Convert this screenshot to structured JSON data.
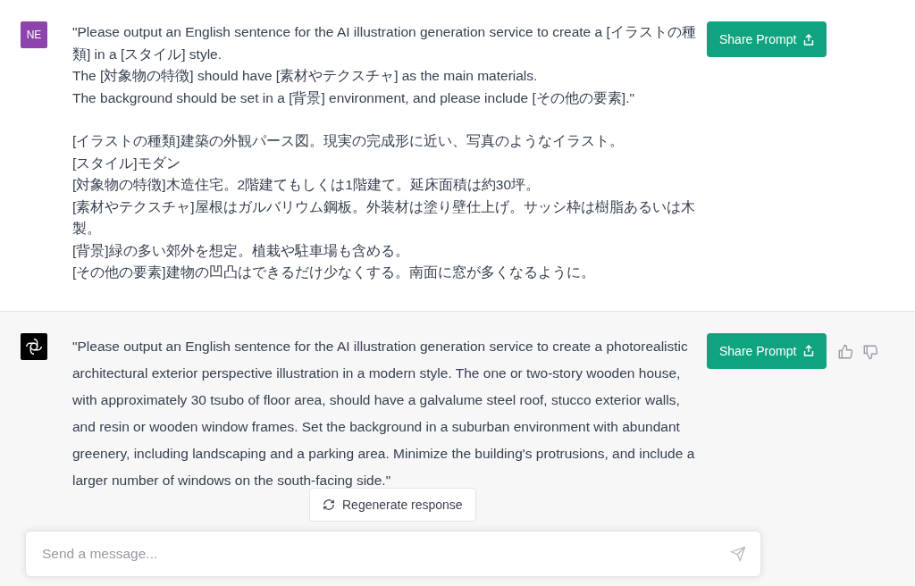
{
  "messages": [
    {
      "kind": "user",
      "avatar": "NE",
      "share_button": "Share Prompt",
      "paragraphs": [
        [
          "\"Please output an English sentence for the AI illustration generation service to create a [イラストの種類] in a [スタイル] style.",
          "The [対象物の特徴] should have [素材やテクスチャ] as the main materials.",
          "The background should be set in a [背景] environment, and please include [その他の要素].\""
        ],
        [
          "[イラストの種類]建築の外観パース図。現実の完成形に近い、写真のようなイラスト。",
          "[スタイル]モダン",
          "[対象物の特徴]木造住宅。2階建てもしくは1階建て。延床面積は約30坪。",
          "[素材やテクスチャ]屋根はガルバリウム鋼板。外装材は塗り壁仕上げ。サッシ枠は樹脂あるいは木製。",
          "[背景]緑の多い郊外を想定。植栽や駐車場も含める。",
          "[その他の要素]建物の凹凸はできるだけ少なくする。南面に窓が多くなるように。"
        ]
      ]
    },
    {
      "kind": "assistant",
      "share_button": "Share Prompt",
      "paragraphs": [
        [
          "\"Please output an English sentence for the AI illustration generation service to create a photorealistic architectural exterior perspective illustration in a modern style. The one or two-story wooden house, with approximately 30 tsubo of floor area, should have a galvalume steel roof, stucco exterior walls, and resin or wooden window frames. Set the background in a suburban environment with abundant greenery, including landscaping and a parking area. Minimize the building's protrusions, and include a larger number of windows on the south-facing side.\""
        ]
      ]
    }
  ],
  "regenerate_button": "Regenerate response",
  "composer": {
    "placeholder": "Send a message..."
  }
}
